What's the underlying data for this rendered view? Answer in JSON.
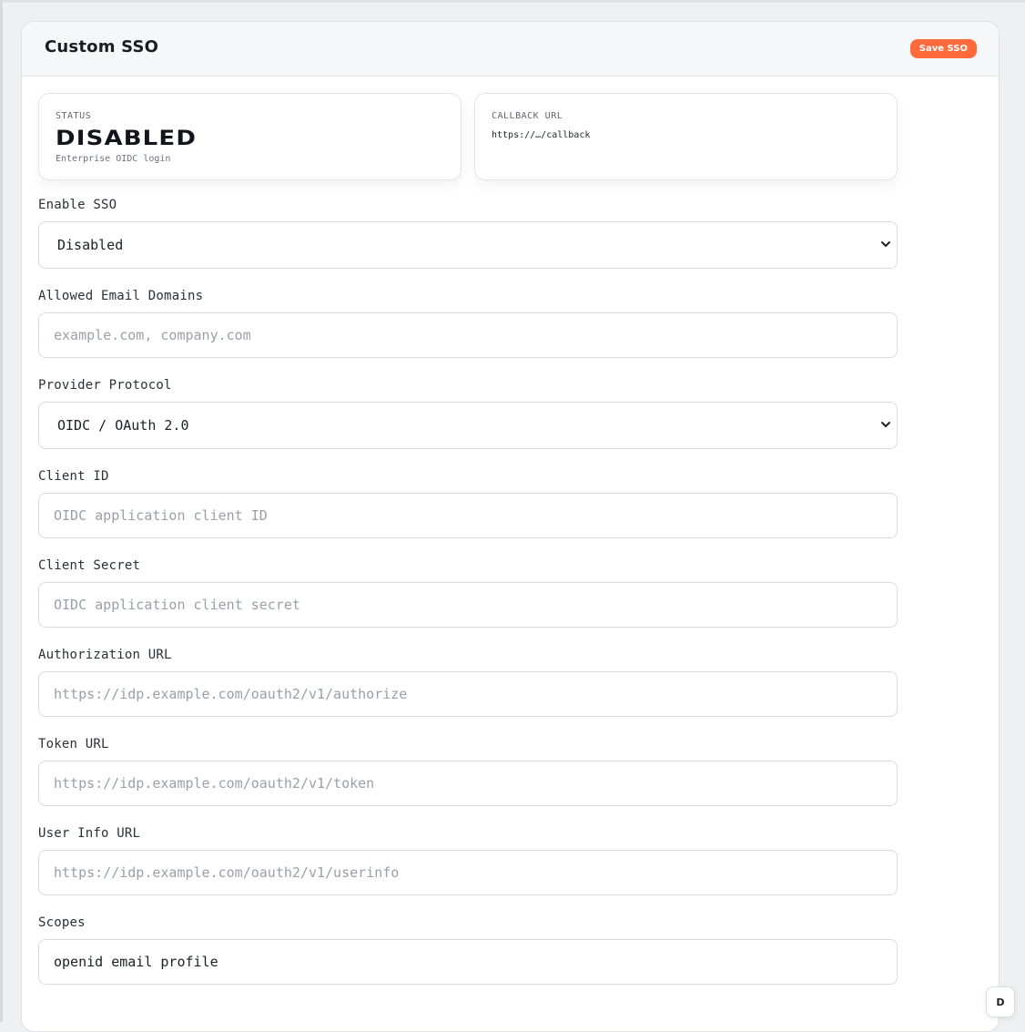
{
  "header": {
    "title": "Custom SSO",
    "save_label": "Save SSO"
  },
  "status_card": {
    "label": "STATUS",
    "value": "DISABLED",
    "subtitle": "Enterprise OIDC login"
  },
  "callback_card": {
    "label": "CALLBACK URL",
    "value": "https://…/callback"
  },
  "form": {
    "enable_sso": {
      "label": "Enable SSO",
      "value": "Disabled"
    },
    "allowed_domains": {
      "label": "Allowed Email Domains",
      "value": "",
      "placeholder": "example.com, company.com"
    },
    "provider_protocol": {
      "label": "Provider Protocol",
      "value": "OIDC / OAuth 2.0"
    },
    "client_id": {
      "label": "Client ID",
      "value": "",
      "placeholder": "OIDC application client ID"
    },
    "client_secret": {
      "label": "Client Secret",
      "value": "",
      "placeholder": "OIDC application client secret"
    },
    "authorization_url": {
      "label": "Authorization URL",
      "value": "",
      "placeholder": "https://idp.example.com/oauth2/v1/authorize"
    },
    "token_url": {
      "label": "Token URL",
      "value": "",
      "placeholder": "https://idp.example.com/oauth2/v1/token"
    },
    "userinfo_url": {
      "label": "User Info URL",
      "value": "",
      "placeholder": "https://idp.example.com/oauth2/v1/userinfo"
    },
    "scopes": {
      "label": "Scopes",
      "value": "openid email profile",
      "placeholder": ""
    }
  },
  "floating_badge": {
    "label": "D"
  },
  "colors": {
    "accent": "#ff6a3d",
    "background": "#eef0f2",
    "card": "#ffffff",
    "header_bg": "#f5f7f9",
    "border": "#d7dbe0"
  },
  "icons": {
    "select_chevron": "chevron-down-icon"
  }
}
